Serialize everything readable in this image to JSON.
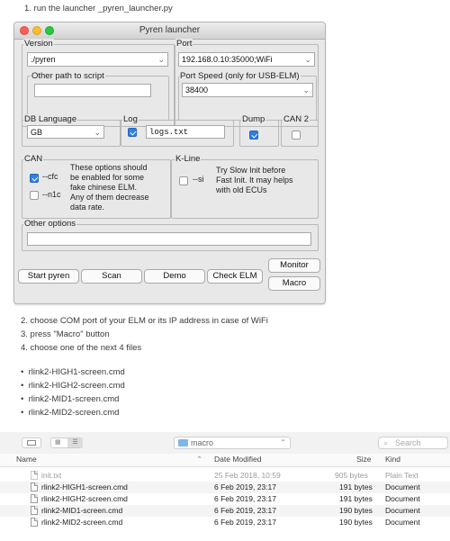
{
  "doc": {
    "step1": "1. run the launcher _pyren_launcher.py",
    "step2": "2. choose COM port of your ELM or its IP address in case of WiFi",
    "step3": "3. press \"Macro\" button",
    "step4": "4. choose one of the next 4 files",
    "bullets": [
      "rlink2-HIGH1-screen.cmd",
      "rlink2-HIGH2-screen.cmd",
      "rlink2-MID1-screen.cmd",
      "rlink2-MID2-screen.cmd"
    ]
  },
  "launcher": {
    "title": "Pyren launcher",
    "version": {
      "label": "Version",
      "value": "./pyren"
    },
    "other_path": {
      "label": "Other path to script",
      "value": ""
    },
    "port": {
      "label": "Port",
      "value": "192.168.0.10:35000;WiFi"
    },
    "port_speed": {
      "label": "Port Speed (only for USB-ELM)",
      "value": "38400"
    },
    "db_language": {
      "label": "DB Language",
      "value": "GB"
    },
    "log": {
      "label": "Log",
      "checked": true,
      "value": "logs.txt"
    },
    "dump": {
      "label": "Dump",
      "checked": true
    },
    "can2": {
      "label": "CAN 2",
      "checked": false
    },
    "can": {
      "label": "CAN",
      "cfc": {
        "label": "--cfc",
        "checked": true
      },
      "n1c": {
        "label": "--n1c",
        "checked": false
      },
      "description": [
        "These options should",
        "be enabled for some",
        "fake chinese ELM.",
        "Any of them decrease",
        "data rate."
      ]
    },
    "kline": {
      "label": "K-Line",
      "si": {
        "label": "--si",
        "checked": false
      },
      "description": [
        "Try Slow Init before",
        "Fast Init. It may helps",
        "with old ECUs"
      ]
    },
    "other_options": {
      "label": "Other options",
      "value": ""
    },
    "buttons": {
      "start": "Start pyren",
      "scan": "Scan",
      "demo": "Demo",
      "check_elm": "Check ELM",
      "monitor": "Monitor",
      "macro": "Macro"
    }
  },
  "finder": {
    "folder": "macro",
    "search_placeholder": "Search",
    "columns": {
      "name": "Name",
      "date": "Date Modified",
      "size": "Size",
      "kind": "Kind"
    },
    "rows": [
      {
        "name": "init.txt",
        "date": "25 Feb 2018, 10:59",
        "size": "905 bytes",
        "kind": "Plain Text",
        "dimmed": true
      },
      {
        "name": "rlink2-HIGH1-screen.cmd",
        "date": "6 Feb 2019, 23:17",
        "size": "191 bytes",
        "kind": "Document",
        "dimmed": false
      },
      {
        "name": "rlink2-HIGH2-screen.cmd",
        "date": "6 Feb 2019, 23:17",
        "size": "191 bytes",
        "kind": "Document",
        "dimmed": false
      },
      {
        "name": "rlink2-MID1-screen.cmd",
        "date": "6 Feb 2019, 23:17",
        "size": "190 bytes",
        "kind": "Document",
        "dimmed": false
      },
      {
        "name": "rlink2-MID2-screen.cmd",
        "date": "6 Feb 2019, 23:17",
        "size": "190 bytes",
        "kind": "Document",
        "dimmed": false
      }
    ]
  },
  "colors": {
    "accent": "#2f7fe5",
    "window_bg": "#e8e8e8",
    "folder": "#7fb6ea"
  }
}
